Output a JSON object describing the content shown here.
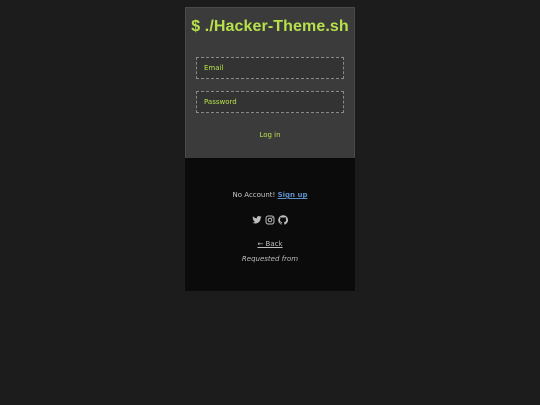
{
  "header": {
    "title": "$ ./Hacker-Theme.sh"
  },
  "form": {
    "email_placeholder": "Email",
    "email_value": "",
    "password_placeholder": "Password",
    "password_value": "",
    "login_label": "Log in"
  },
  "footer": {
    "no_account_text": "No Account!",
    "signup_label": "Sign up",
    "social_icons": [
      "twitter-icon",
      "instagram-icon",
      "github-icon"
    ],
    "back_label": "← Back",
    "requested_from": "Requested from"
  },
  "colors": {
    "accent": "#b7e04b",
    "link": "#5b8fc6",
    "background": "#1c1c1c",
    "card_top": "#3b3b3b",
    "card_bottom": "#0b0b0b"
  }
}
